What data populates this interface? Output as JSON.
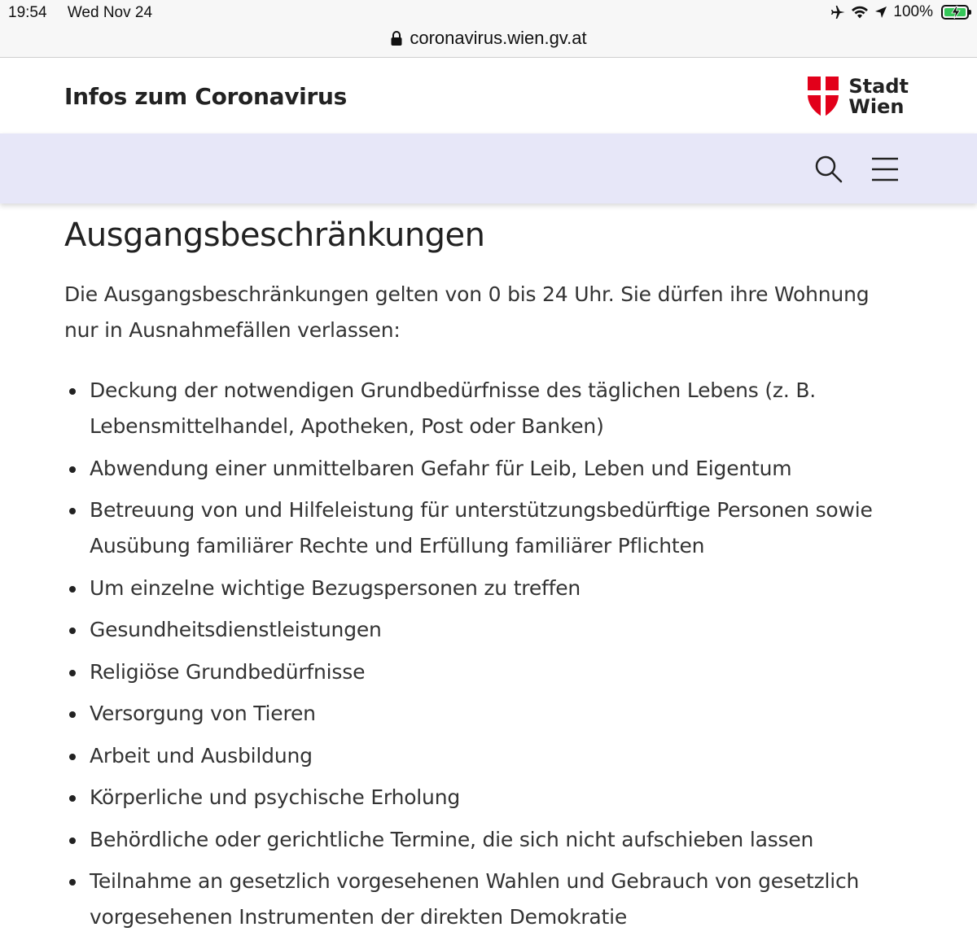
{
  "status_bar": {
    "time": "19:54",
    "date": "Wed Nov 24",
    "battery": "100%",
    "battery_level": 1.0,
    "icons": [
      "airplane-icon",
      "wifi-icon",
      "location-icon",
      "battery-charging-icon"
    ]
  },
  "browser": {
    "url": "coronavirus.wien.gv.at"
  },
  "header": {
    "title": "Infos zum Coronavirus",
    "logo_line1": "Stadt",
    "logo_line2": "Wien"
  },
  "colors": {
    "nav_band": "#e7e7f8",
    "logo_red": "#e2001a"
  },
  "main": {
    "heading": "Ausgangsbeschränkungen",
    "intro": "Die Ausgangsbeschränkungen gelten von 0 bis 24 Uhr. Sie dürfen ihre Wohnung nur in Ausnahmefällen verlassen:",
    "items": [
      "Deckung der notwendigen Grundbedürfnisse des täglichen Lebens (z. B. Lebensmittelhandel, Apotheken, Post oder Banken)",
      "Abwendung einer unmittelbaren Gefahr für Leib, Leben und Eigentum",
      "Betreuung von und Hilfeleistung für unterstützungsbedürftige Personen sowie Ausübung familiärer Rechte und Erfüllung familiärer Pflichten",
      "Um einzelne wichtige Bezugspersonen zu treffen",
      "Gesundheitsdienstleistungen",
      "Religiöse Grundbedürfnisse",
      "Versorgung von Tieren",
      "Arbeit und Ausbildung",
      "Körperliche und psychische Erholung",
      "Behördliche oder gerichtliche Termine, die sich nicht aufschieben lassen",
      "Teilnahme an gesetzlich vorgesehenen Wahlen und Gebrauch von gesetzlich vorgesehenen Instrumenten der direkten Demokratie"
    ]
  }
}
